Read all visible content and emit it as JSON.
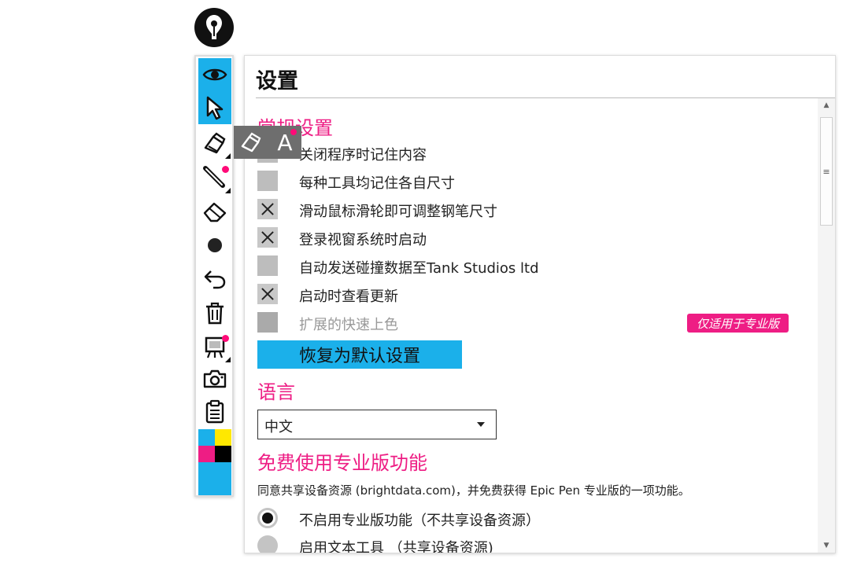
{
  "colors": {
    "accent": "#1bb0ea",
    "heading": "#ee1d84",
    "badge": "#ee1d84",
    "toolbar_swatches": [
      "#1bb0ea",
      "#ffe800",
      "#ee1d84",
      "#000000"
    ],
    "current_color": "#1bb0ea"
  },
  "toolbar": {
    "icons": [
      "logo-icon",
      "eye-icon",
      "cursor-icon",
      "pen-icon",
      "highlighter-icon",
      "eraser-icon",
      "brush-size-icon",
      "undo-icon",
      "trash-icon",
      "board-icon",
      "camera-icon",
      "clipboard-icon"
    ]
  },
  "flyout": {
    "icons": [
      "marker-icon",
      "text-icon"
    ],
    "text_glyph": "A"
  },
  "settings": {
    "title": "设置",
    "general": {
      "heading": "常规设置",
      "items": [
        {
          "label": "关闭程序时记住内容",
          "checked": false
        },
        {
          "label": "每种工具均记住各自尺寸",
          "checked": false
        },
        {
          "label": "滑动鼠标滑轮即可调整钢笔尺寸",
          "checked": true
        },
        {
          "label": "登录视窗系统时启动",
          "checked": true
        },
        {
          "label": "自动发送碰撞数据至Tank Studios ltd",
          "checked": false
        },
        {
          "label": "启动时查看更新",
          "checked": true
        },
        {
          "label": "扩展的快速上色",
          "checked": false,
          "disabled": true
        }
      ],
      "pro_badge": "仅适用于专业版",
      "reset_button": "恢复为默认设置"
    },
    "language": {
      "heading": "语言",
      "selected": "中文"
    },
    "free_pro": {
      "heading": "免费使用专业版功能",
      "description": "同意共享设备资源 (brightdata.com)，并免费获得 Epic Pen 专业版的一项功能。",
      "options": [
        {
          "label": "不启用专业版功能（不共享设备资源）",
          "selected": true
        },
        {
          "label": "启用文本工具 （共享设备资源)",
          "selected": false
        }
      ]
    }
  }
}
